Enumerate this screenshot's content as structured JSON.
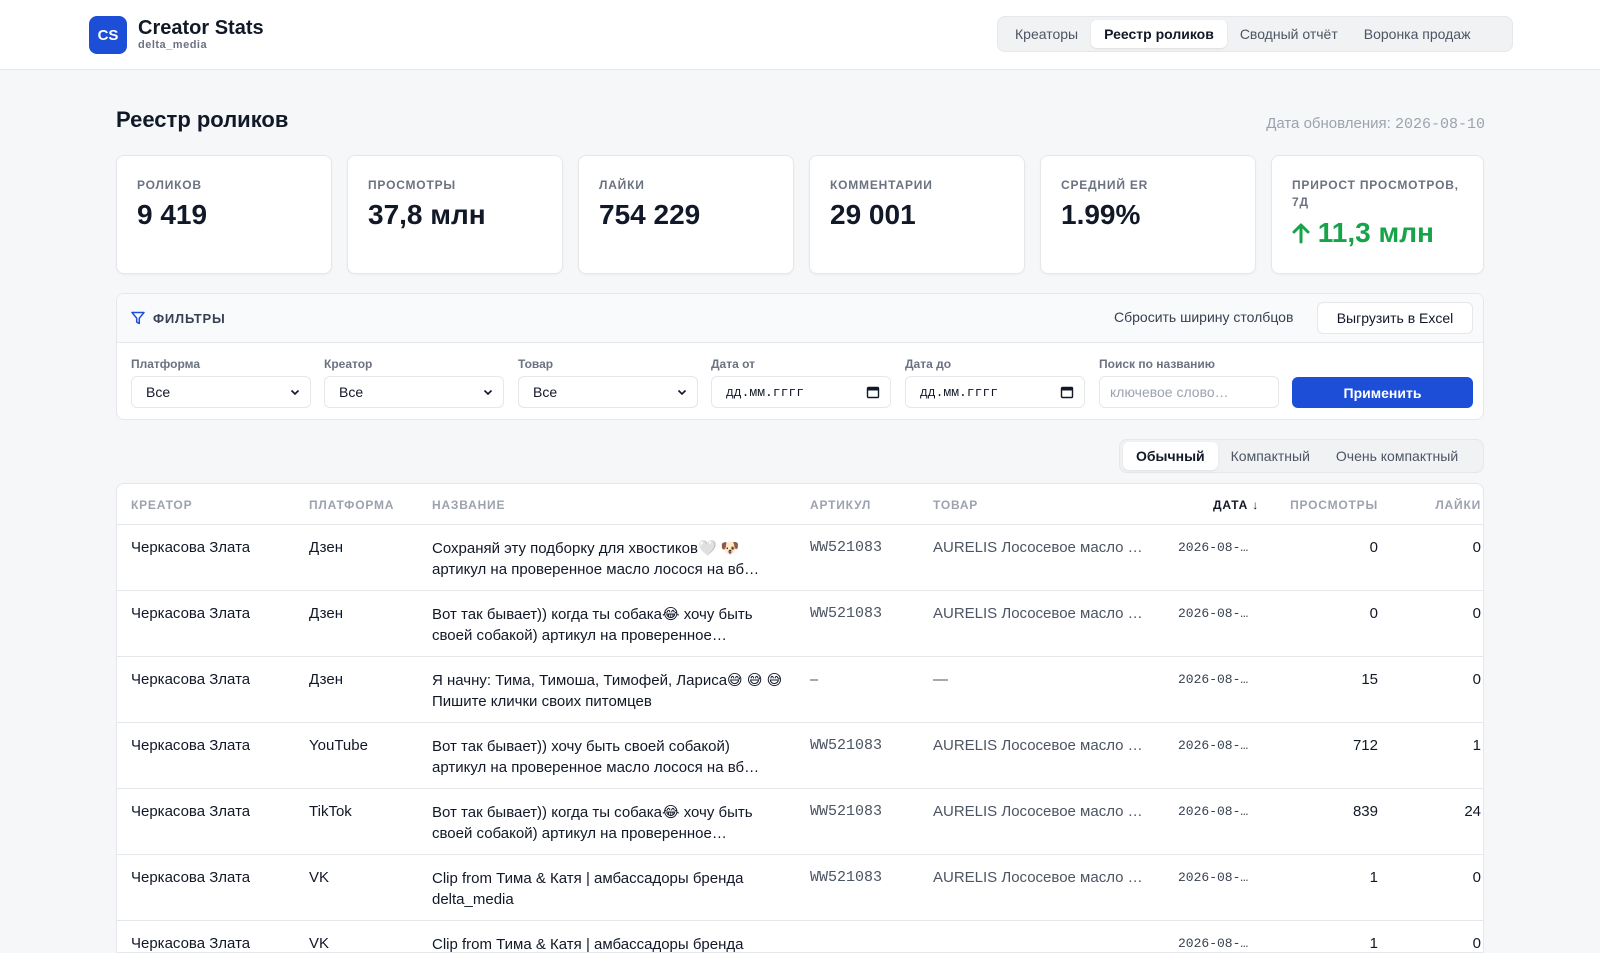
{
  "app": {
    "logo": "CS",
    "title": "Creator Stats",
    "subtitle": "delta_media"
  },
  "nav": {
    "tabs": [
      {
        "label": "Креаторы",
        "active": false
      },
      {
        "label": "Реестр роликов",
        "active": true
      },
      {
        "label": "Сводный отчёт",
        "active": false
      },
      {
        "label": "Воронка продаж",
        "active": false
      }
    ]
  },
  "page": {
    "title": "Реестр роликов",
    "updated_label": "Дата обновления:",
    "updated_date": "2026-08-10"
  },
  "kpis": [
    {
      "label": "Роликов",
      "value": "9 419"
    },
    {
      "label": "Просмотры",
      "value": "37,8 млн"
    },
    {
      "label": "Лайки",
      "value": "754 229"
    },
    {
      "label": "Комментарии",
      "value": "29 001"
    },
    {
      "label": "Средний ER",
      "value": "1.99%"
    },
    {
      "label": "Прирост просмотров, 7д",
      "value": "11,3 млн",
      "trend": "up",
      "color": "#16a34a"
    }
  ],
  "filters": {
    "title": "ФИЛЬТРЫ",
    "reset_label": "Сбросить ширину столбцов",
    "export_label": "Выгрузить в Excel",
    "platform": {
      "label": "Платформа",
      "value": "Все"
    },
    "creator": {
      "label": "Креатор",
      "value": "Все"
    },
    "product": {
      "label": "Товар",
      "value": "Все"
    },
    "date_from": {
      "label": "Дата от",
      "value": "дд.мм.гггг"
    },
    "date_to": {
      "label": "Дата до",
      "value": "дд.мм.гггг"
    },
    "search": {
      "label": "Поиск по названию",
      "placeholder": "ключевое слово…"
    },
    "apply_label": "Применить"
  },
  "density": {
    "options": [
      {
        "label": "Обычный",
        "active": true
      },
      {
        "label": "Компактный",
        "active": false
      },
      {
        "label": "Очень компактный",
        "active": false
      }
    ]
  },
  "table": {
    "columns": {
      "creator": "Креатор",
      "platform": "Платформа",
      "title": "Название",
      "sku": "Артикул",
      "product": "Товар",
      "date": "Дата ↓",
      "views": "Просмотры",
      "likes": "Лайки"
    },
    "rows": [
      {
        "creator": "Черкасова Злата",
        "platform": "Дзен",
        "title": "Сохраняй эту подборку для хвостиков🤍 🐶 артикул на проверенное масло лосося на вб…",
        "sku": "WW521083",
        "product": "AURELIS Лососевое масло …",
        "date": "2026-08-…",
        "views": "0",
        "likes": "0"
      },
      {
        "creator": "Черкасова Злата",
        "platform": "Дзен",
        "title": "Вот так бывает)) когда ты собака😂 хочу быть своей собакой) артикул на проверенное…",
        "sku": "WW521083",
        "product": "AURELIS Лососевое масло …",
        "date": "2026-08-…",
        "views": "0",
        "likes": "0"
      },
      {
        "creator": "Черкасова Злата",
        "platform": "Дзен",
        "title": "Я начну: Тима, Тимоша, Тимофей, Лариса😅 😅 😅 Пишите клички своих питомцев",
        "sku": "–",
        "product": "—",
        "date": "2026-08-…",
        "views": "15",
        "likes": "0"
      },
      {
        "creator": "Черкасова Злата",
        "platform": "YouTube",
        "title": "Вот так бывает)) хочу быть своей собакой) артикул на проверенное масло лосося на вб…",
        "sku": "WW521083",
        "product": "AURELIS Лососевое масло …",
        "date": "2026-08-…",
        "views": "712",
        "likes": "1"
      },
      {
        "creator": "Черкасова Злата",
        "platform": "TikTok",
        "title": "Вот так бывает)) когда ты собака😂 хочу быть своей собакой) артикул на проверенное…",
        "sku": "WW521083",
        "product": "AURELIS Лососевое масло …",
        "date": "2026-08-…",
        "views": "839",
        "likes": "24"
      },
      {
        "creator": "Черкасова Злата",
        "platform": "VK",
        "title": "Clip from Тима & Катя | амбассадоры бренда delta_media",
        "sku": "WW521083",
        "product": "AURELIS Лососевое масло …",
        "date": "2026-08-…",
        "views": "1",
        "likes": "0"
      },
      {
        "creator": "Черкасова Злата",
        "platform": "VK",
        "title": "Clip from Тима & Катя | амбассадоры бренда",
        "sku": "",
        "product": "",
        "date": "2026-08-…",
        "views": "1",
        "likes": "0"
      }
    ]
  }
}
